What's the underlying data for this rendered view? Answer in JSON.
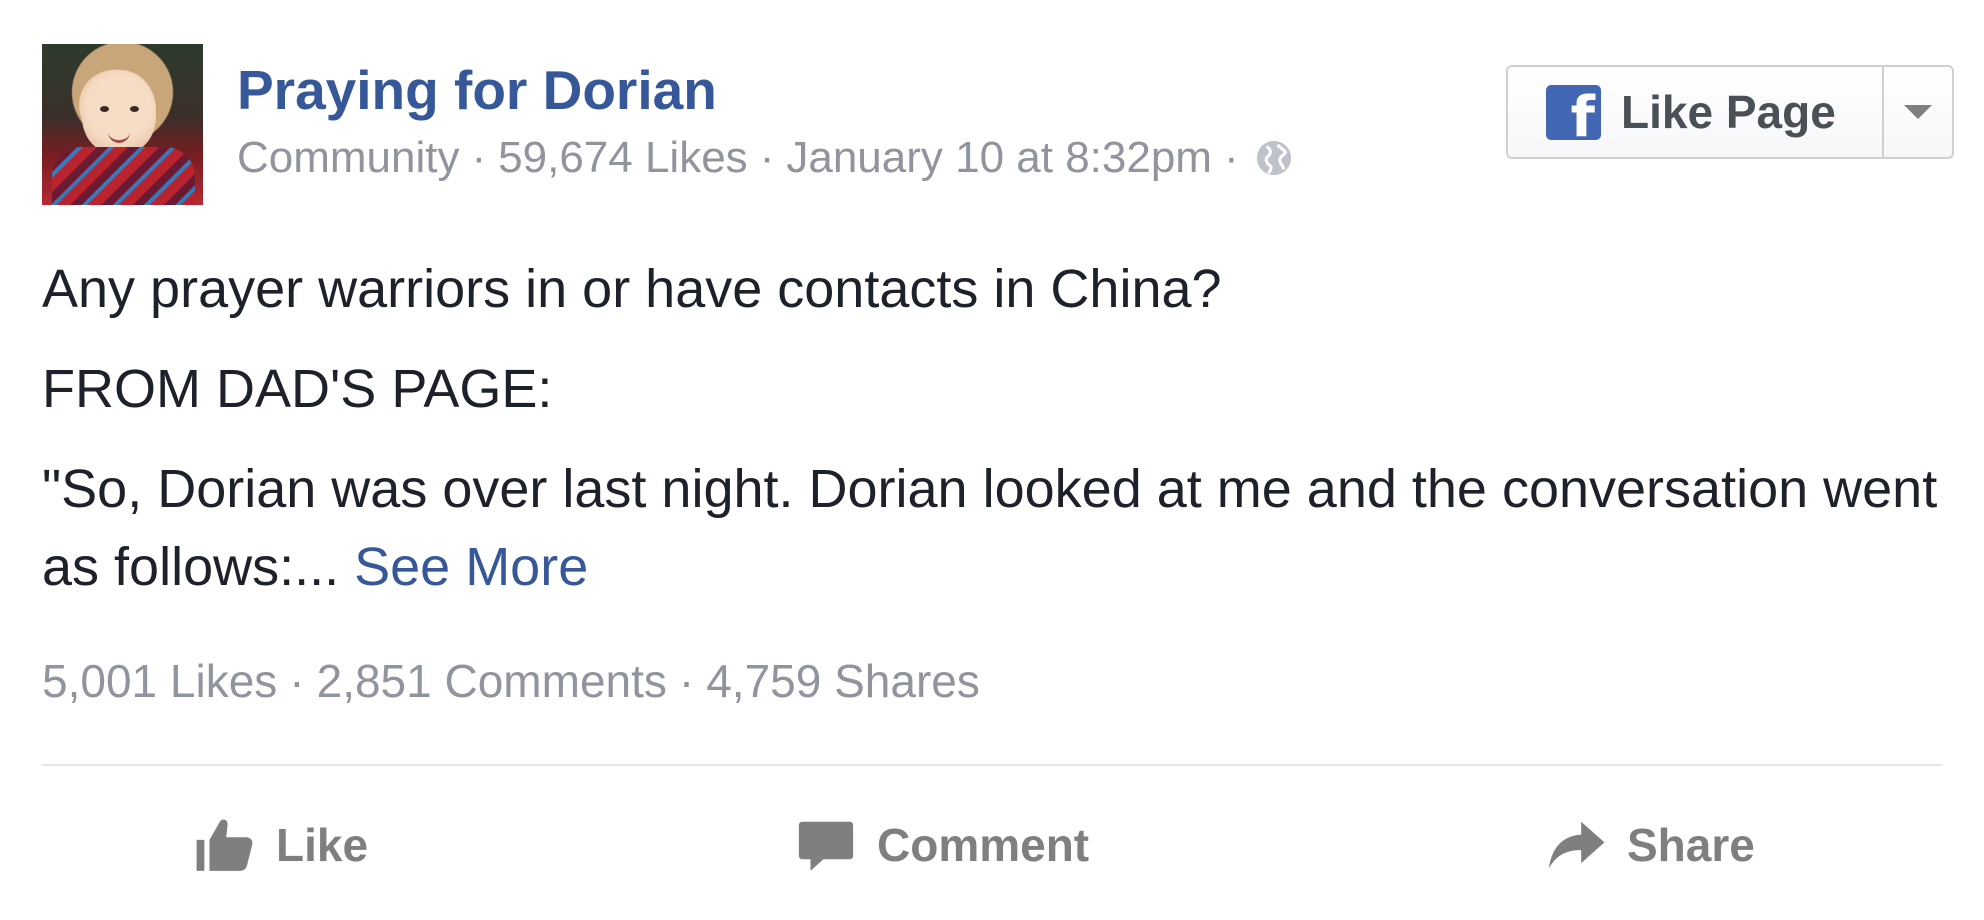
{
  "post": {
    "page_name": "Praying for Dorian",
    "page_category": "Community",
    "page_likes": "59,674 Likes",
    "timestamp": "January 10 at 8:32pm",
    "separator": "·",
    "privacy_icon": "globe-icon"
  },
  "like_page_button": {
    "label": "Like Page",
    "logo_letter": "f",
    "logo_color": "#4267b2",
    "dropdown_icon": "chevron-down-icon"
  },
  "body": {
    "line1": "Any prayer warriors in or have contacts in China?",
    "line2": "FROM DAD'S PAGE:",
    "line3": "\"So, Dorian was over last night. Dorian looked at me and the conversation went as follows:... ",
    "see_more": "See More"
  },
  "stats": {
    "likes": "5,001 Likes",
    "comments": "2,851 Comments",
    "shares": "4,759 Shares",
    "separator": "·"
  },
  "actions": {
    "like": "Like",
    "comment": "Comment",
    "share": "Share",
    "icons": [
      "thumbs-up-icon",
      "comment-icon",
      "share-arrow-icon"
    ]
  },
  "colors": {
    "link": "#365899",
    "meta": "#90949c",
    "text": "#1d2129",
    "action": "#7f7f7f"
  }
}
